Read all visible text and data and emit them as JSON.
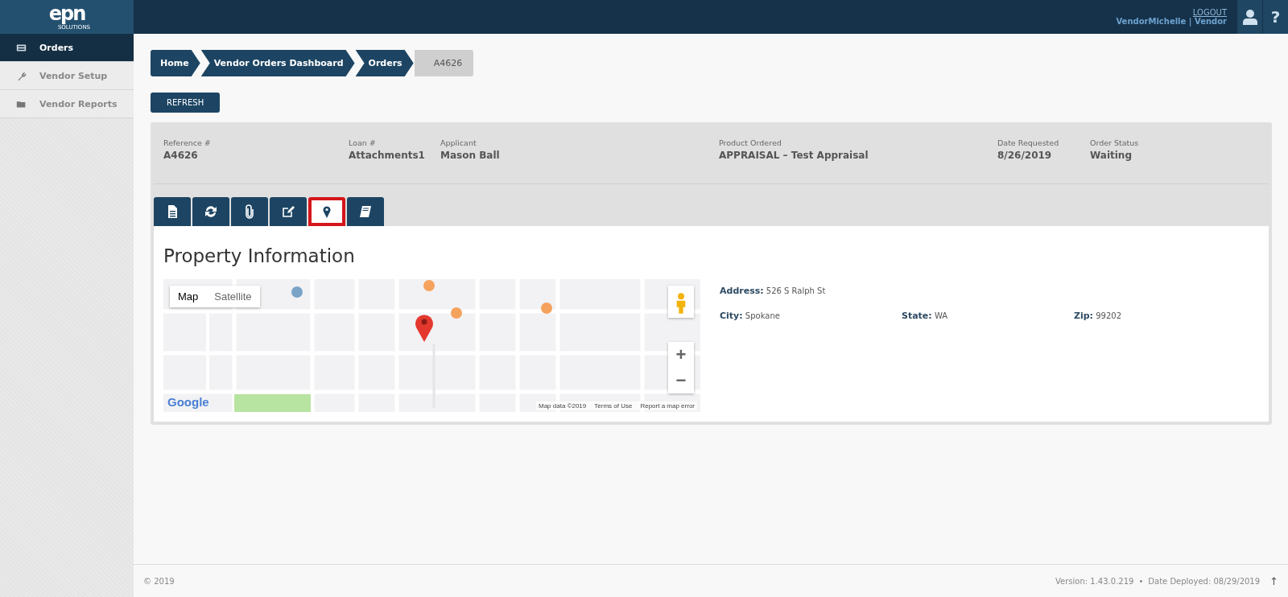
{
  "logo": {
    "mark": "epn",
    "sub": "SOLUTIONS"
  },
  "header": {
    "logout": "LOGOUT",
    "user": "VendorMichelle",
    "separator": "|",
    "role": "Vendor",
    "buttons": [
      {
        "kind": "user"
      },
      {
        "kind": "help",
        "label": "?"
      }
    ]
  },
  "sidebar": {
    "items": [
      {
        "label": "Orders",
        "selected": true
      },
      {
        "label": "Vendor Setup",
        "selected": false
      },
      {
        "label": "Vendor Reports",
        "selected": false
      }
    ]
  },
  "breadcrumb": [
    {
      "label": "Home",
      "current": false
    },
    {
      "label": "Vendor Orders Dashboard",
      "current": false
    },
    {
      "label": "Orders",
      "current": false
    },
    {
      "label": "A4626",
      "current": true
    }
  ],
  "refresh_button": "REFRESH",
  "summary": [
    {
      "label": "Reference #",
      "value": "A4626"
    },
    {
      "label": "Loan #",
      "value": "Attachments1"
    },
    {
      "label": "Applicant",
      "value": "Mason Ball"
    },
    {
      "label": "Product Ordered",
      "value": "APPRAISAL – Test Appraisal"
    },
    {
      "label": "Date Requested",
      "value": "8/26/2019"
    },
    {
      "label": "Order Status",
      "value": "Waiting"
    }
  ],
  "tabs": [
    {
      "kind": "document",
      "selected": false,
      "highlighted": false
    },
    {
      "kind": "refresh",
      "selected": false,
      "highlighted": false
    },
    {
      "kind": "paperclip",
      "selected": false,
      "highlighted": false
    },
    {
      "kind": "edit",
      "selected": false,
      "highlighted": false
    },
    {
      "kind": "pin",
      "selected": true,
      "highlighted": true
    },
    {
      "kind": "book",
      "selected": false,
      "highlighted": false
    }
  ],
  "section_title": "Property Information",
  "map": {
    "map_types": [
      {
        "label": "Map",
        "selected": true
      },
      {
        "label": "Satellite",
        "selected": false
      }
    ],
    "zoom_in": "+",
    "zoom_out": "−",
    "logo": "Google",
    "attribution": [
      "Map data ©2019",
      "Terms of Use",
      "Report a map error"
    ]
  },
  "property": [
    {
      "label": "Address:",
      "value": "526 S Ralph St"
    },
    {
      "label": "City:",
      "value": "Spokane"
    },
    {
      "label": "State:",
      "value": "WA"
    },
    {
      "label": "Zip:",
      "value": "99202"
    }
  ],
  "footer": {
    "copyright": "© 2019",
    "version": "Version: 1.43.0.219",
    "bullet": "•",
    "deployed": "Date Deployed: 08/29/2019",
    "top_arrow": "↑"
  }
}
